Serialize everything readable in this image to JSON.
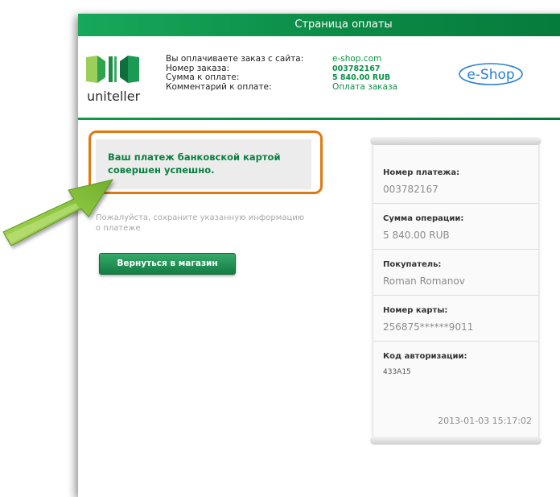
{
  "header": {
    "title": "Страница оплаты"
  },
  "brand": {
    "name": "uniteller",
    "merchant_logo": "e-Shop"
  },
  "order_info": {
    "labels": [
      "Вы оплачиваете заказ с сайта:",
      "Номер заказа:",
      "Сумма к оплате:",
      "Комментарий к оплате:"
    ],
    "values": [
      "e-shop.com",
      "003782167",
      "5 840.00 RUB",
      "Оплата заказа"
    ]
  },
  "message": {
    "success_line1": "Ваш платеж банковской картой",
    "success_line2": "совершен успешно.",
    "note_line1": "Пожалуйста, сохраните указанную информацию",
    "note_line2": "о платеже"
  },
  "actions": {
    "return_label": "Вернуться в магазин"
  },
  "receipt": {
    "fields": [
      {
        "label": "Номер платежа:",
        "value": "003782167"
      },
      {
        "label": "Сумма операции:",
        "value": "5 840.00 RUB"
      },
      {
        "label": "Покупатель:",
        "value": "Roman Romanov"
      },
      {
        "label": "Номер карты:",
        "value": "256875******9011"
      },
      {
        "label": "Код авторизации:",
        "value": "433A15"
      }
    ],
    "datetime": "2013-01-03 15:17:02"
  },
  "colors": {
    "brand_green": "#0b8a45",
    "highlight_orange": "#e07a10",
    "arrow_green": "#8cc63f"
  },
  "icons": {
    "annotation": "arrow-icon",
    "logo": "uniteller-logo-icon"
  }
}
